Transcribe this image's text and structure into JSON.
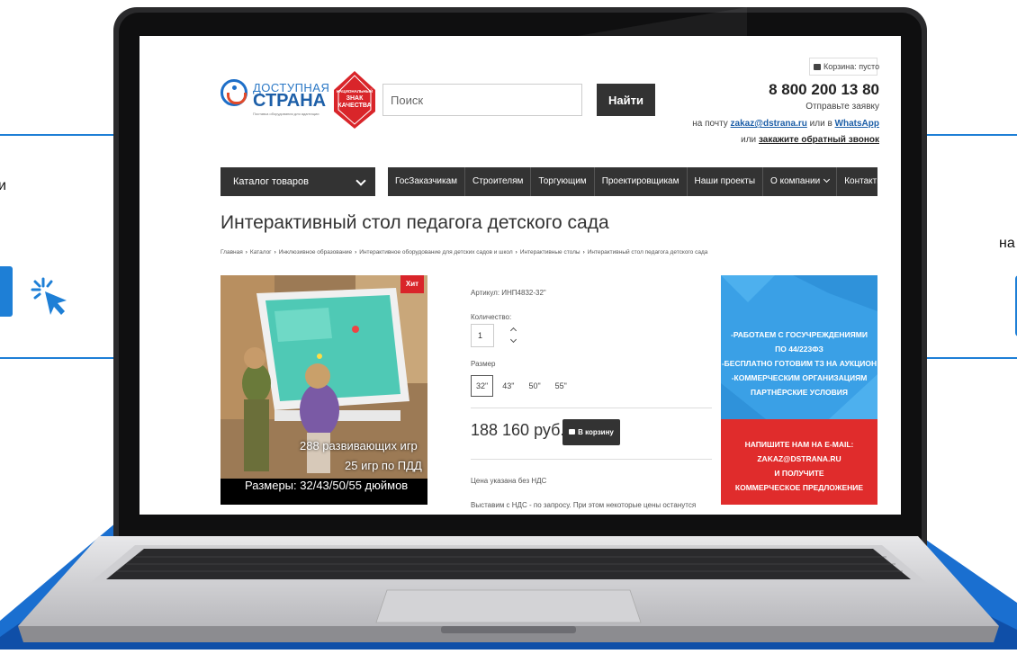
{
  "background": {
    "left_cut_text": "и",
    "right_cut_text": "на",
    "accent_color": "#1e7fd6",
    "cursor_icon": "click-cursor-icon"
  },
  "site": {
    "logo": {
      "line1": "ДОСТУПНАЯ",
      "line2": "СТРАНА",
      "tagline": "Поставка оборудования для адаптации"
    },
    "quality_badge": [
      "НАЦИОНАЛЬНЫЙ",
      "ЗНАК",
      "КАЧЕСТВА"
    ],
    "search": {
      "placeholder": "Поиск",
      "button": "Найти"
    },
    "cart": {
      "label": "Корзина: пусто"
    },
    "contacts": {
      "phone": "8 800 200 13 80",
      "request": "Отправьте заявку",
      "mail_prefix": "на почту ",
      "email": "zakaz@dstrana.ru",
      "mail_or": " или в ",
      "whatsapp": "WhatsApp",
      "call_prefix": "или ",
      "callback": "закажите обратный звонок"
    },
    "catalog_menu": "Каталог товаров",
    "nav": [
      "ГосЗаказчикам",
      "Строителям",
      "Торгующим",
      "Проектировщикам",
      "Наши проекты",
      "О компании",
      "Контакты"
    ]
  },
  "product": {
    "title": "Интерактивный стол педагога детского сада",
    "breadcrumbs": [
      "Главная",
      "Каталог",
      "Инклюзивное образование",
      "Интерактивное оборудование для детских садов и школ",
      "Интерактивные столы",
      "Интерактивный стол педагога детского сада"
    ],
    "badge": "Хит",
    "photo_caption": [
      "288 развивающих игр",
      "25 игр по ПДД",
      "Размеры: 32/43/50/55 дюймов"
    ],
    "article": "Артикул: ИНП4832-32\"",
    "quantity_label": "Количество:",
    "quantity": "1",
    "size_label": "Размер",
    "sizes": [
      "32\"",
      "43\"",
      "50\"",
      "55\""
    ],
    "selected_size": "32\"",
    "price": "188 160 руб.",
    "cart_button": "В корзину",
    "nds_note": "Цена указана без НДС",
    "nds_note2": "Выставим с НДС - по запросу. При этом некоторые цены останутся"
  },
  "banner": {
    "top_lines": [
      "-РАБОТАЕМ С ГОСУЧРЕЖДЕНИЯМИ",
      "ПО 44/223ФЗ",
      "-БЕСПЛАТНО ГОТОВИМ ТЗ НА АУКЦИОН",
      "-КОММЕРЧЕСКИМ ОРГАНИЗАЦИЯМ",
      "ПАРТНЁРСКИЕ УСЛОВИЯ"
    ],
    "bottom_lines": [
      "НАПИШИТЕ НАМ НА E-MAIL:",
      "ZAKAZ@DSTRANA.RU",
      "И ПОЛУЧИТЕ",
      "КОММЕРЧЕСКОЕ ПРЕДЛОЖЕНИЕ"
    ],
    "top_color": "#3aa0e6",
    "bottom_color": "#e02c2c"
  }
}
